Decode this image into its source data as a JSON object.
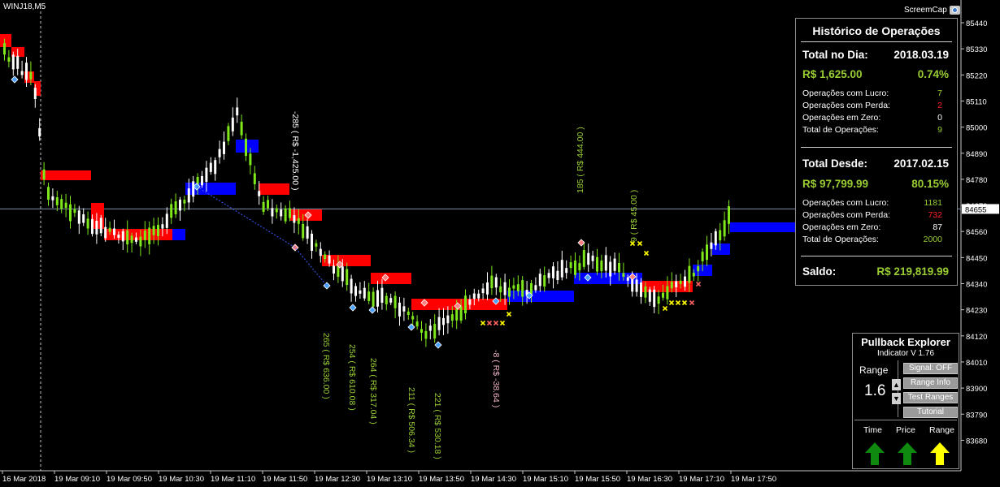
{
  "chart": {
    "symbol": "WINJ18,M5",
    "screencap_label": "ScreemCap",
    "price_labels": [
      "85440",
      "85330",
      "85220",
      "85110",
      "85000",
      "84890",
      "84780",
      "84670",
      "84560",
      "84450",
      "84340",
      "84230",
      "84120",
      "84010",
      "83900",
      "83790",
      "83680"
    ],
    "current_price": "84655",
    "time_labels": [
      "16 Mar 2018",
      "19 Mar 09:10",
      "19 Mar 09:50",
      "19 Mar 10:30",
      "19 Mar 11:10",
      "19 Mar 11:50",
      "19 Mar 12:30",
      "19 Mar 13:10",
      "19 Mar 13:50",
      "19 Mar 14:30",
      "19 Mar 15:10",
      "19 Mar 15:50",
      "19 Mar 16:30",
      "19 Mar 17:10",
      "19 Mar 17:50"
    ],
    "trade_annotations": [
      {
        "text": "-285 ( R$ -1,425.00 )",
        "color": "#ffffff"
      },
      {
        "text": "265 ( R$ 636.00 )",
        "color": "#9acd32"
      },
      {
        "text": "254 ( R$ 610.08 )",
        "color": "#9acd32"
      },
      {
        "text": "264 ( R$ 317.04 )",
        "color": "#9acd32"
      },
      {
        "text": "211 ( R$ 506.34 )",
        "color": "#9acd32"
      },
      {
        "text": "221 ( R$ 530.18 )",
        "color": "#9acd32"
      },
      {
        "text": "-8 ( R$ -38.64 )",
        "color": "#f2b6c6"
      },
      {
        "text": "185 ( R$ 444.00 )",
        "color": "#9acd32"
      },
      {
        "text": "9 ( R$ 45.00 )",
        "color": "#9acd32"
      }
    ]
  },
  "history": {
    "title": "Histórico de Operações",
    "day": {
      "label": "Total no Dia:",
      "date": "2018.03.19",
      "amount": "R$ 1,625.00",
      "percent": "0.74%",
      "rows": [
        {
          "label": "Operações com Lucro:",
          "value": "7"
        },
        {
          "label": "Operações com Perda:",
          "value": "2"
        },
        {
          "label": "Operações em Zero:",
          "value": "0"
        },
        {
          "label": "Total de Operações:",
          "value": "9"
        }
      ]
    },
    "since": {
      "label": "Total Desde:",
      "date": "2017.02.15",
      "amount": "R$ 97,799.99",
      "percent": "80.15%",
      "rows": [
        {
          "label": "Operações com Lucro:",
          "value": "1181"
        },
        {
          "label": "Operações com Perda:",
          "value": "732"
        },
        {
          "label": "Operações em Zero:",
          "value": "87"
        },
        {
          "label": "Total de Operações:",
          "value": "2000"
        }
      ]
    },
    "balance_label": "Saldo:",
    "balance_value": "R$ 219,819.99"
  },
  "explorer": {
    "title": "Pullback Explorer",
    "subtitle": "Indicator V 1.76",
    "range_label": "Range",
    "range_value": "1.6",
    "buttons": [
      "Signal: OFF",
      "Range Info",
      "Test Ranges",
      "Tutorial"
    ],
    "arrows": [
      {
        "label": "Time",
        "color": "#0f8a0f"
      },
      {
        "label": "Price",
        "color": "#0f8a0f"
      },
      {
        "label": "Range",
        "color": "#ffff00"
      }
    ]
  },
  "colors": {
    "bull": "#7ee81a",
    "bear": "#ffffff",
    "band_up": "#0000ff",
    "band_down": "#ff0000",
    "accent_green": "#9acd32",
    "loss_red": "#ff2020"
  }
}
